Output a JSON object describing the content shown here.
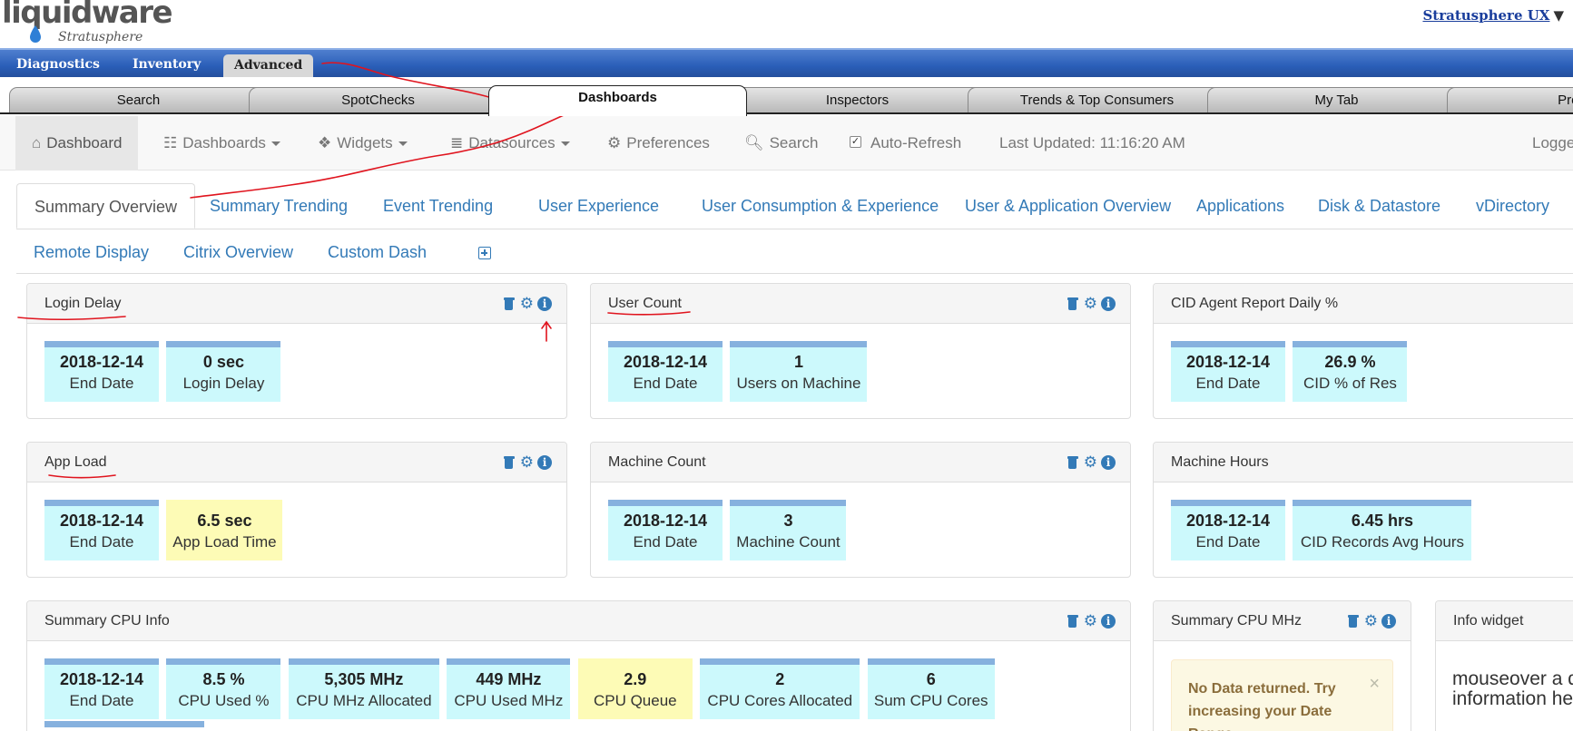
{
  "brand": {
    "logo_text": "liquidware",
    "logo_sub": "Stratusphere"
  },
  "user_menu": {
    "label": "Stratusphere UX",
    "arrow": "▼"
  },
  "top_nav": [
    "Diagnostics",
    "Inventory",
    "Advanced"
  ],
  "tabs": [
    "Search",
    "SpotChecks",
    "Dashboards",
    "Inspectors",
    "Trends & Top Consumers",
    "My Tab",
    "Prefer"
  ],
  "dash_nav": {
    "dashboard": "Dashboard",
    "dashboards": "Dashboards",
    "widgets": "Widgets",
    "datasources": "Datasources",
    "preferences": "Preferences",
    "search": "Search",
    "auto_refresh": "Auto-Refresh",
    "last_updated": "Last Updated: 11:16:20 AM",
    "logged": "Logge"
  },
  "sub_tabs": [
    "Summary Overview",
    "Summary Trending",
    "Event Trending",
    "User Experience",
    "User Consumption & Experience",
    "User & Application Overview",
    "Applications",
    "Disk & Datastore",
    "vDirectory",
    "Remote Display",
    "Citrix Overview",
    "Custom Dash"
  ],
  "widgets": {
    "login_delay": {
      "title": "Login Delay",
      "tiles": [
        {
          "value": "2018-12-14",
          "label": "End Date"
        },
        {
          "value": "0 sec",
          "label": "Login Delay"
        }
      ]
    },
    "user_count": {
      "title": "User Count",
      "tiles": [
        {
          "value": "2018-12-14",
          "label": "End Date"
        },
        {
          "value": "1",
          "label": "Users on Machine"
        }
      ]
    },
    "cid_agent": {
      "title": "CID Agent Report Daily %",
      "tiles": [
        {
          "value": "2018-12-14",
          "label": "End Date"
        },
        {
          "value": "26.9 %",
          "label": "CID % of Res"
        }
      ]
    },
    "app_load": {
      "title": "App Load",
      "tiles": [
        {
          "value": "2018-12-14",
          "label": "End Date"
        },
        {
          "value": "6.5 sec",
          "label": "App Load Time"
        }
      ]
    },
    "machine_count": {
      "title": "Machine Count",
      "tiles": [
        {
          "value": "2018-12-14",
          "label": "End Date"
        },
        {
          "value": "3",
          "label": "Machine Count"
        }
      ]
    },
    "machine_hours": {
      "title": "Machine Hours",
      "tiles": [
        {
          "value": "2018-12-14",
          "label": "End Date"
        },
        {
          "value": "6.45 hrs",
          "label": "CID Records Avg Hours"
        }
      ]
    },
    "summary_cpu": {
      "title": "Summary CPU Info",
      "tiles": [
        {
          "value": "2018-12-14",
          "label": "End Date"
        },
        {
          "value": "8.5 %",
          "label": "CPU Used %"
        },
        {
          "value": "5,305 MHz",
          "label": "CPU MHz Allocated"
        },
        {
          "value": "449 MHz",
          "label": "CPU Used MHz"
        },
        {
          "value": "2.9",
          "label": "CPU Queue"
        },
        {
          "value": "2",
          "label": "CPU Cores Allocated"
        },
        {
          "value": "6",
          "label": "Sum CPU Cores"
        }
      ]
    },
    "summary_cpu_mhz": {
      "title": "Summary CPU MHz",
      "alert": "No Data returned. Try increasing your Date Range",
      "close": "×"
    },
    "info_widget": {
      "title": "Info widget",
      "text": "mouseover a display exten information he"
    }
  },
  "colors": {
    "link": "#337ab7",
    "tile_bg": "#ccf9fc",
    "tile_bar": "#86b1de",
    "tile_warn": "#fdfbb6",
    "nav_blue": "#2a5eb8",
    "annotation": "#e0141e"
  }
}
